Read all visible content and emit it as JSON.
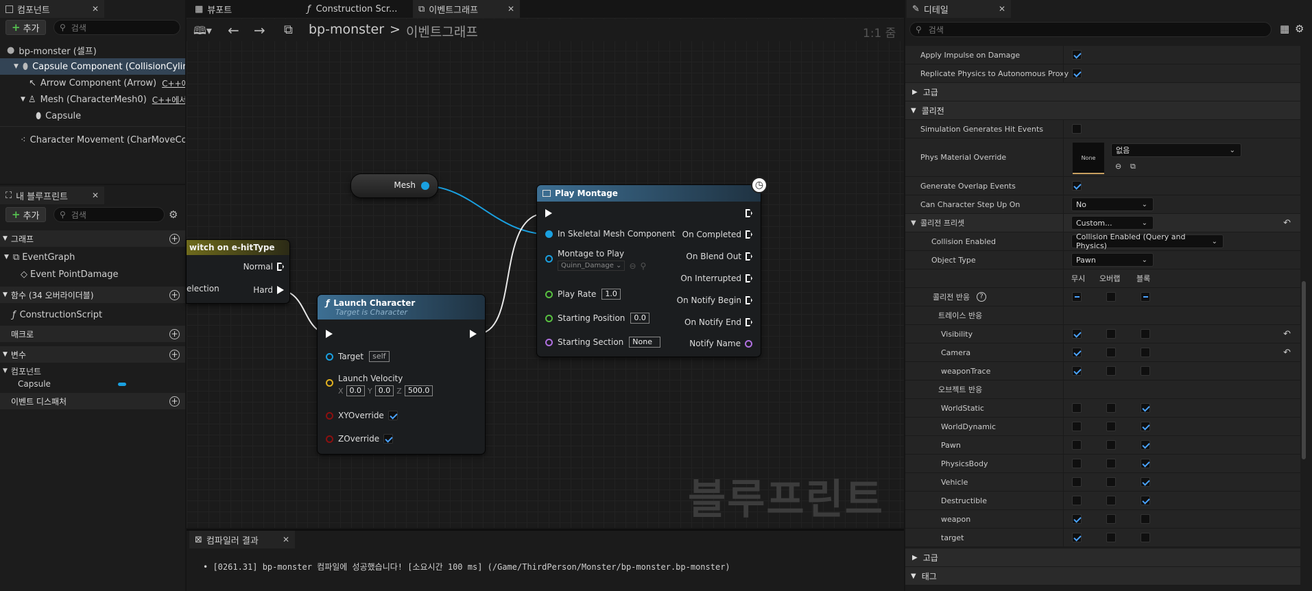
{
  "components": {
    "tab": "컴포넌트",
    "add": "추가",
    "search": "검색",
    "items": [
      {
        "label": "bp-monster (셀프)"
      },
      {
        "label": "Capsule Component (CollisionCylinder)"
      },
      {
        "label": "Arrow Component (Arrow)",
        "tag": "C++에서"
      },
      {
        "label": "Mesh (CharacterMesh0)",
        "tag": "C++에서 편"
      },
      {
        "label": "Capsule"
      },
      {
        "label": "Character Movement (CharMoveComp)"
      }
    ]
  },
  "my_blueprint": {
    "tab": "내 블루프린트",
    "add": "추가",
    "search": "검색",
    "sections": {
      "graph": "그래프",
      "functions": "함수 (34 오버라이더블)",
      "macros": "매크로",
      "variables": "변수",
      "dispatchers": "이벤트 디스패처"
    },
    "eventgraph": "EventGraph",
    "event": "Event PointDamage",
    "construction": "ConstructionScript",
    "components_cat": "컴포넌트",
    "capsule_var": "Capsule"
  },
  "tabs": {
    "viewport": "뷰포트",
    "construction": "Construction Scr...",
    "eventgraph": "이벤트그래프"
  },
  "graph": {
    "breadcrumb_root": "bp-monster",
    "breadcrumb_sep": ">",
    "breadcrumb_page": "이벤트그래프",
    "zoom": "1:1 줌",
    "watermark": "블루프린트",
    "nodes": {
      "mesh": {
        "label": "Mesh"
      },
      "switch": {
        "title": "witch on e-hitType",
        "selection": "election",
        "normal": "Normal",
        "hard": "Hard"
      },
      "launch": {
        "title": "Launch Character",
        "subtitle": "Target is Character",
        "target": "Target",
        "target_val": "self",
        "velocity": "Launch Velocity",
        "x": "0.0",
        "y": "0.0",
        "z": "500.0",
        "xy": "XYOverride",
        "zo": "ZOverride"
      },
      "montage": {
        "title": "Play Montage",
        "in_mesh": "In Skeletal Mesh Component",
        "montage": "Montage to Play",
        "montage_val": "Quinn_Damage",
        "rate": "Play Rate",
        "rate_val": "1.0",
        "start_pos": "Starting Position",
        "start_pos_val": "0.0",
        "start_sec": "Starting Section",
        "start_sec_val": "None",
        "on_completed": "On Completed",
        "on_blend_out": "On Blend Out",
        "on_interrupted": "On Interrupted",
        "on_notify_begin": "On Notify Begin",
        "on_notify_end": "On Notify End",
        "notify_name": "Notify Name"
      }
    }
  },
  "compiler": {
    "tab": "컴파일러 결과",
    "message": "[0261.31] bp-monster 컴파일에 성공했습니다! [소요시간 100 ms] (/Game/ThirdPerson/Monster/bp-monster.bp-monster)"
  },
  "details": {
    "tab": "디테일",
    "search": "검색",
    "apply_impulse": "Apply Impulse on Damage",
    "replicate": "Replicate Physics to Autonomous Proxy",
    "advanced": "고급",
    "collision": "콜리전",
    "sim_hit": "Simulation Generates Hit Events",
    "phys_mat": "Phys Material Override",
    "phys_thumb": "None",
    "phys_val": "없음",
    "overlap": "Generate Overlap Events",
    "step_up": "Can Character Step Up On",
    "step_up_val": "No",
    "preset": "콜리전 프리셋",
    "preset_val": "Custom...",
    "enabled": "Collision Enabled",
    "enabled_val": "Collision Enabled (Query and Physics)",
    "obj_type": "Object Type",
    "obj_type_val": "Pawn",
    "col_ignore": "무시",
    "col_overlap": "오버랩",
    "col_block": "블록",
    "response": "콜리전 반응",
    "trace": "트레이스 반응",
    "object": "오브젝트 반응",
    "trace_rows": [
      {
        "name": "Visibility",
        "v": 0
      },
      {
        "name": "Camera",
        "v": 0
      },
      {
        "name": "weaponTrace",
        "v": 0
      }
    ],
    "object_rows": [
      {
        "name": "WorldStatic",
        "v": 2
      },
      {
        "name": "WorldDynamic",
        "v": 2
      },
      {
        "name": "Pawn",
        "v": 2
      },
      {
        "name": "PhysicsBody",
        "v": 2
      },
      {
        "name": "Vehicle",
        "v": 2
      },
      {
        "name": "Destructible",
        "v": 2
      },
      {
        "name": "weapon",
        "v": 0
      },
      {
        "name": "target",
        "v": 0
      }
    ],
    "advanced2": "고급",
    "tags": "태그"
  }
}
